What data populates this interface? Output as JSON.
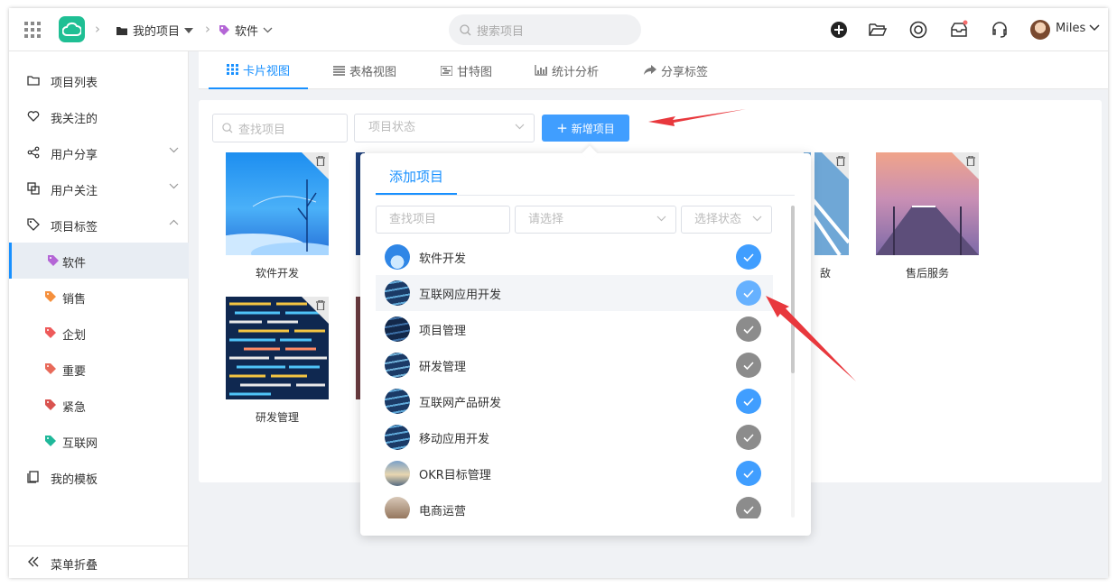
{
  "header": {
    "breadcrumb": [
      {
        "label": "我的项目"
      },
      {
        "label": "软件"
      }
    ],
    "search_placeholder": "搜索项目",
    "user_name": "Miles"
  },
  "sidebar": {
    "items": [
      {
        "label": "项目列表"
      },
      {
        "label": "我关注的"
      },
      {
        "label": "用户分享"
      },
      {
        "label": "用户关注"
      },
      {
        "label": "项目标签"
      }
    ],
    "tags": [
      {
        "label": "软件",
        "color": "#b466d6"
      },
      {
        "label": "销售",
        "color": "#f5903d"
      },
      {
        "label": "企划",
        "color": "#ee5a5a"
      },
      {
        "label": "重要",
        "color": "#e86a5a"
      },
      {
        "label": "紧急",
        "color": "#d9534f"
      },
      {
        "label": "互联网",
        "color": "#1fb89a"
      }
    ],
    "templates": "我的模板",
    "collapse": "菜单折叠"
  },
  "tabs": [
    {
      "label": "卡片视图"
    },
    {
      "label": "表格视图"
    },
    {
      "label": "甘特图"
    },
    {
      "label": "统计分析"
    },
    {
      "label": "分享标签"
    }
  ],
  "toolbar": {
    "search_placeholder": "查找项目",
    "status_placeholder": "项目状态",
    "new_button": "新增项目"
  },
  "cards": [
    {
      "name": "软件开发"
    },
    {
      "name": "售后服务"
    },
    {
      "name": "研发管理"
    },
    {
      "name_partial": "敌"
    }
  ],
  "popover": {
    "tab": "添加项目",
    "search_placeholder": "查找项目",
    "select_placeholder": "请选择",
    "status_placeholder": "选择状态",
    "items": [
      {
        "label": "软件开发",
        "checked": true
      },
      {
        "label": "互联网应用开发",
        "checked": true
      },
      {
        "label": "项目管理",
        "checked": false
      },
      {
        "label": "研发管理",
        "checked": false
      },
      {
        "label": "互联网产品研发",
        "checked": true
      },
      {
        "label": "移动应用开发",
        "checked": false
      },
      {
        "label": "OKR目标管理",
        "checked": true
      },
      {
        "label": "电商运营",
        "checked": false
      }
    ]
  },
  "colors": {
    "primary": "#409eff",
    "accent": "#1890ff",
    "annotation_arrow": "#e8383d"
  }
}
